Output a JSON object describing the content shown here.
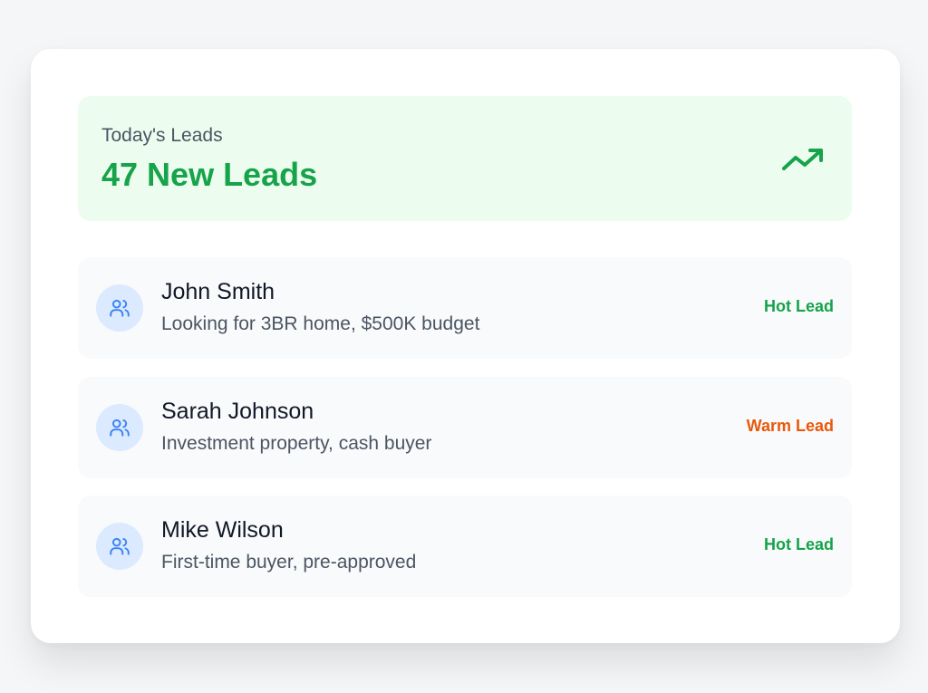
{
  "summary": {
    "label": "Today's Leads",
    "value": "47 New Leads",
    "icon": "trending-up-icon",
    "accent_color": "#16a34a",
    "background_color": "#ecfdf0"
  },
  "leads": [
    {
      "name": "John Smith",
      "description": "Looking for 3BR home, $500K budget",
      "status": "Hot Lead",
      "status_color": "#16a34a",
      "icon": "users-icon"
    },
    {
      "name": "Sarah Johnson",
      "description": "Investment property, cash buyer",
      "status": "Warm Lead",
      "status_color": "#ea580c",
      "icon": "users-icon"
    },
    {
      "name": "Mike Wilson",
      "description": "First-time buyer, pre-approved",
      "status": "Hot Lead",
      "status_color": "#16a34a",
      "icon": "users-icon"
    }
  ]
}
